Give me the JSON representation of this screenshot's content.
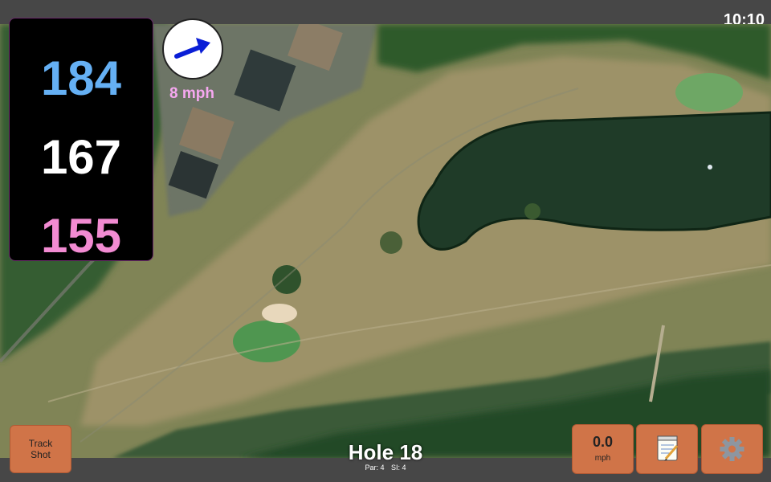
{
  "status": {
    "time": "10:10"
  },
  "yardages": {
    "back": "184",
    "center": "167",
    "front": "155"
  },
  "wind": {
    "speed_text": "8 mph",
    "icon": "wind-direction-arrow-icon"
  },
  "hole": {
    "title": "Hole 18",
    "par": "Par: 4",
    "si": "SI: 4"
  },
  "buttons": {
    "track_line1": "Track",
    "track_line2": "Shot",
    "speed_value": "0.0",
    "speed_unit": "mph",
    "notes_icon": "notepad-icon",
    "settings_icon": "gear-icon"
  },
  "colors": {
    "back_yardage": "#65b0f4",
    "center_yardage": "#ffffff",
    "front_yardage": "#f28bd2",
    "button_bg": "#d07448",
    "wind_text": "#f6a8f0"
  }
}
